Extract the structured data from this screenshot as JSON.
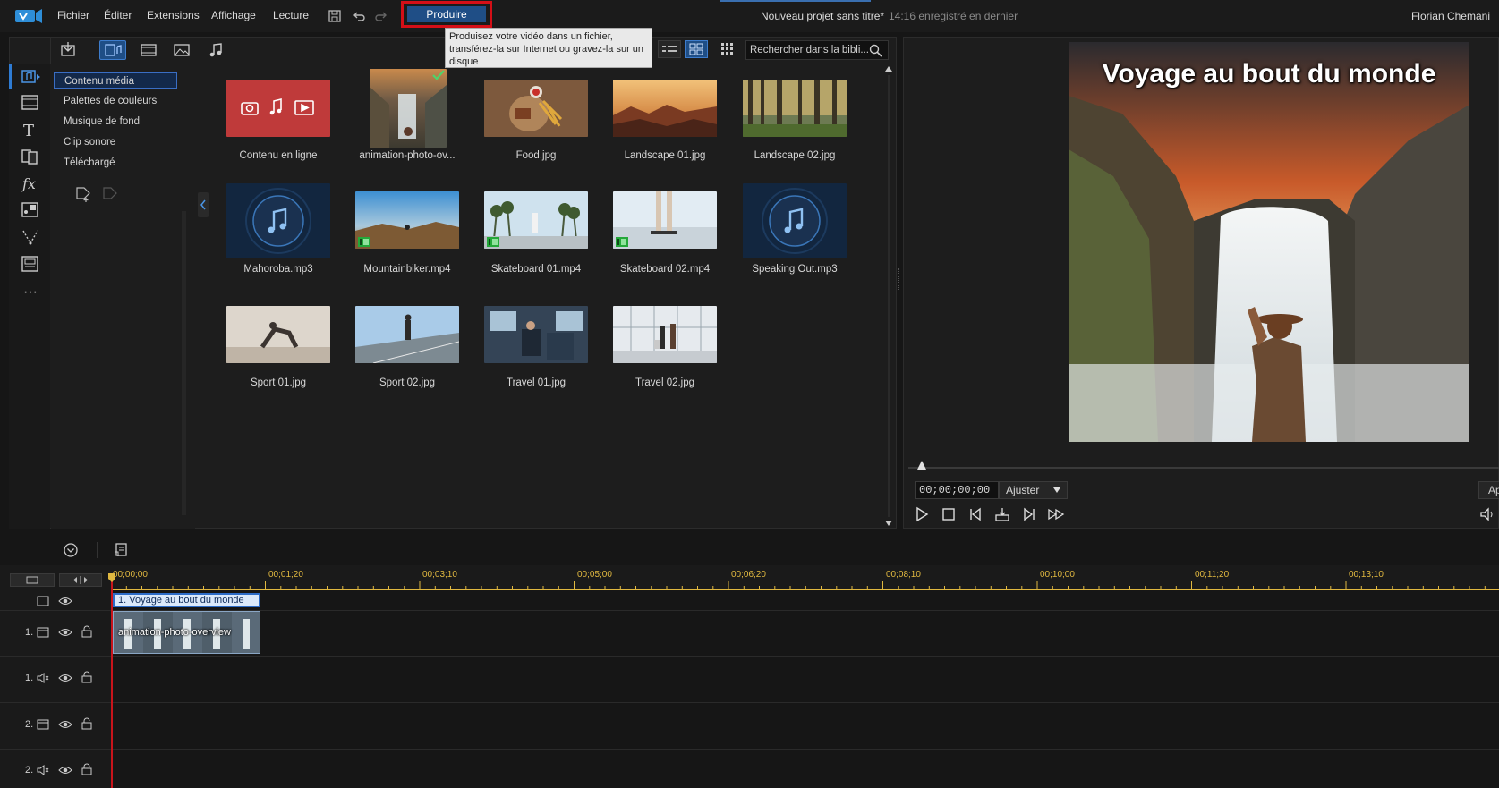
{
  "menubar": {
    "items": [
      "Fichier",
      "Éditer",
      "Extensions",
      "Affichage",
      "Lecture"
    ],
    "produce_label": "Produire",
    "project_title": "Nouveau projet sans titre*",
    "saved_status": "14:16 enregistré en dernier",
    "user": "Florian Chemani"
  },
  "tooltip": {
    "text": "Produisez votre vidéo dans un fichier, transférez-la sur Internet ou gravez-la sur un disque"
  },
  "library": {
    "categories": [
      "Contenu média",
      "Palettes de couleurs",
      "Musique de fond",
      "Clip sonore",
      "Téléchargé"
    ],
    "selected_category": "Contenu média",
    "search_placeholder": "Rechercher dans la bibli...",
    "items": [
      {
        "label": "Contenu en ligne",
        "kind": "online"
      },
      {
        "label": "animation-photo-ov...",
        "kind": "image",
        "checked": true
      },
      {
        "label": "Food.jpg",
        "kind": "image"
      },
      {
        "label": "Landscape 01.jpg",
        "kind": "image"
      },
      {
        "label": "Landscape 02.jpg",
        "kind": "image"
      },
      {
        "label": "Mahoroba.mp3",
        "kind": "audio"
      },
      {
        "label": "Mountainbiker.mp4",
        "kind": "video"
      },
      {
        "label": "Skateboard 01.mp4",
        "kind": "video"
      },
      {
        "label": "Skateboard 02.mp4",
        "kind": "video"
      },
      {
        "label": "Speaking Out.mp3",
        "kind": "audio"
      },
      {
        "label": "Sport 01.jpg",
        "kind": "image"
      },
      {
        "label": "Sport 02.jpg",
        "kind": "image"
      },
      {
        "label": "Travel 01.jpg",
        "kind": "image"
      },
      {
        "label": "Travel 02.jpg",
        "kind": "image"
      }
    ]
  },
  "preview": {
    "caption": "Voyage au bout du monde",
    "timecode": "00;00;00;00",
    "fit_label": "Ajuster",
    "extra_button": "Ap"
  },
  "timeline": {
    "ruler_labels": [
      "00;00;00",
      "00;01;20",
      "00;03;10",
      "00;05;00",
      "00;06;20",
      "00;08;10",
      "00;10;00",
      "00;11;20",
      "00;13;10"
    ],
    "title_clip": "1. Voyage au bout du monde",
    "video_clip": "animation-photo-overview",
    "tracks": [
      {
        "label": "1.",
        "type": "video"
      },
      {
        "label": "1.",
        "type": "audio"
      },
      {
        "label": "2.",
        "type": "video"
      },
      {
        "label": "2.",
        "type": "audio"
      }
    ]
  },
  "colors": {
    "accent": "#1f4e86",
    "highlight_border": "#d40f17",
    "playhead": "#c8141b",
    "ruler_text": "#e0b840"
  }
}
